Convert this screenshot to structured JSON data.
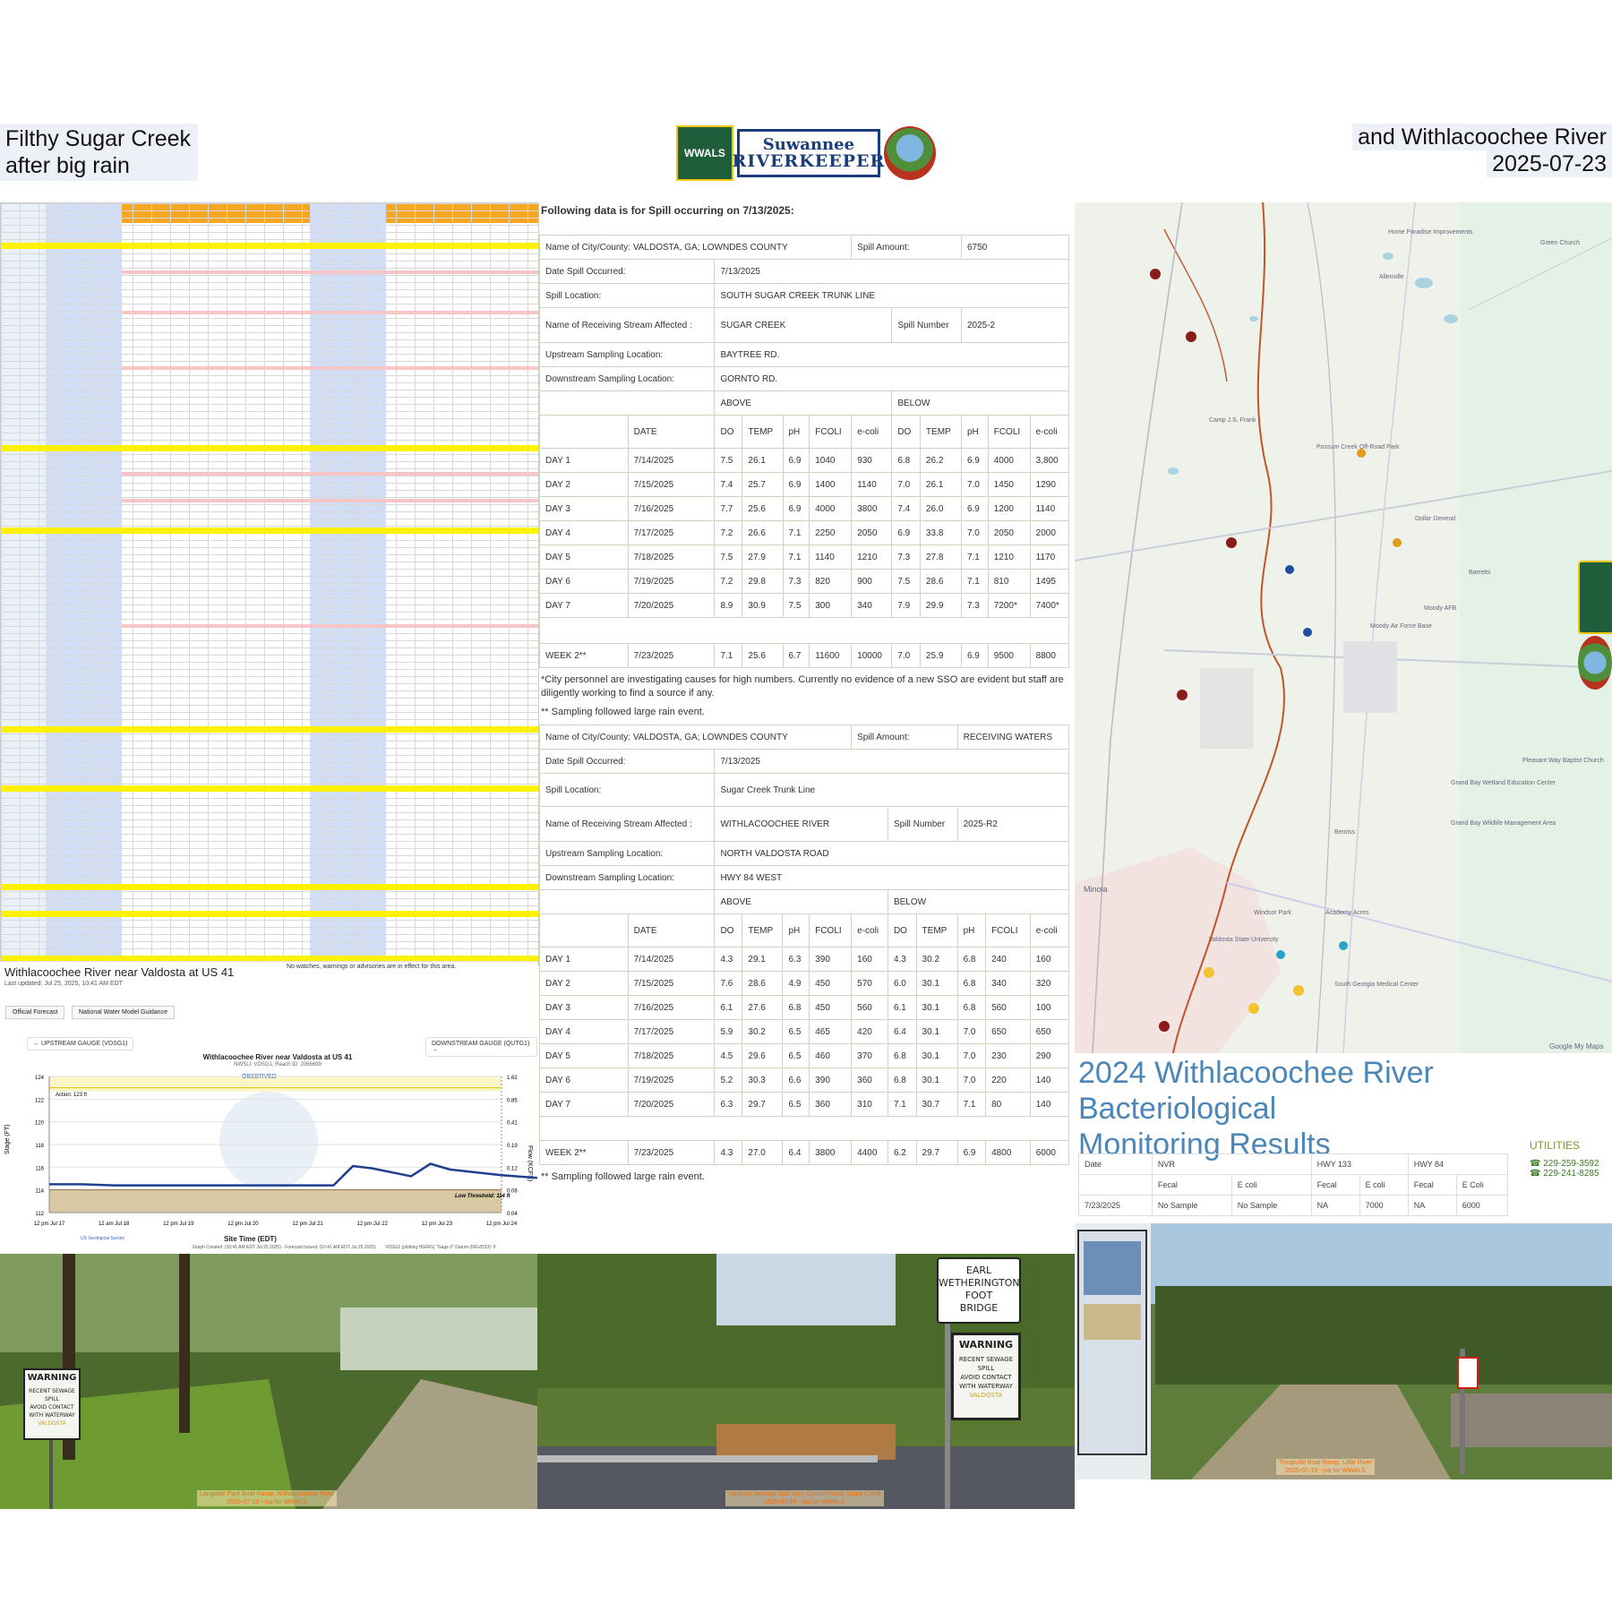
{
  "header": {
    "left_line1": "Filthy Sugar Creek",
    "left_line2": "after big rain",
    "right_line1": "and Withlacoochee River",
    "right_line2": "2025-07-23"
  },
  "logos": {
    "wwals": "WWALS",
    "riverkeeper_line1": "Suwannee",
    "riverkeeper_line2": "RIVERKEEPER",
    "little_river": "Little River"
  },
  "spill_tables": {
    "title": "Following data is for Spill occurring on 7/13/2025:",
    "table1": {
      "city_label": "Name of City/County: VALDOSTA, GA; LOWNDES COUNTY",
      "amount_label": "Spill Amount:",
      "amount_value": "6750",
      "date_label": "Date Spill Occurred:",
      "date_value": "7/13/2025",
      "location_label": "Spill Location:",
      "location_value": "SOUTH SUGAR CREEK TRUNK LINE",
      "stream_label": "Name of Receiving Stream Affected :",
      "stream_value": "SUGAR CREEK",
      "number_label": "Spill Number",
      "number_value": "2025-2",
      "upstream_label": "Upstream Sampling Location:",
      "upstream_value": "BAYTREE RD.",
      "downstream_label": "Downstream Sampling Location:",
      "downstream_value": "GORNTO RD.",
      "above": "ABOVE",
      "below": "BELOW",
      "columns": [
        "DATE",
        "DO",
        "TEMP",
        "pH",
        "FCOLI",
        "e-coli",
        "DO",
        "TEMP",
        "pH",
        "FCOLI",
        "e-coli"
      ],
      "rows": [
        [
          "DAY 1",
          "7/14/2025",
          "7.5",
          "26.1",
          "6.9",
          "1040",
          "930",
          "6.8",
          "26.2",
          "6.9",
          "4000",
          "3,800"
        ],
        [
          "DAY 2",
          "7/15/2025",
          "7.4",
          "25.7",
          "6.9",
          "1400",
          "1140",
          "7.0",
          "26.1",
          "7.0",
          "1450",
          "1290"
        ],
        [
          "DAY 3",
          "7/16/2025",
          "7.7",
          "25.6",
          "6.9",
          "4000",
          "3800",
          "7.4",
          "26.0",
          "6.9",
          "1200",
          "1140"
        ],
        [
          "DAY 4",
          "7/17/2025",
          "7.2",
          "26.6",
          "7.1",
          "2250",
          "2050",
          "6.9",
          "33.8",
          "7.0",
          "2050",
          "2000"
        ],
        [
          "DAY 5",
          "7/18/2025",
          "7.5",
          "27.9",
          "7.1",
          "1140",
          "1210",
          "7.3",
          "27.8",
          "7.1",
          "1210",
          "1170"
        ],
        [
          "DAY 6",
          "7/19/2025",
          "7.2",
          "29.8",
          "7.3",
          "820",
          "900",
          "7.5",
          "28.6",
          "7.1",
          "810",
          "1495"
        ],
        [
          "DAY 7",
          "7/20/2025",
          "8.9",
          "30.9",
          "7.5",
          "300",
          "340",
          "7.9",
          "29.9",
          "7.3",
          "7200*",
          "7400*"
        ]
      ],
      "week_row": [
        "WEEK 2**",
        "7/23/2025",
        "7.1",
        "25.6",
        "6.7",
        "11600",
        "10000",
        "7.0",
        "25.9",
        "6.9",
        "9500",
        "8800"
      ]
    },
    "note1": "*City personnel are investigating causes for high numbers. Currently no evidence of a new SSO are evident but staff are diligently working to find a source if any.",
    "note2": "** Sampling followed large rain event.",
    "table2": {
      "city_label": "Name of City/County: VALDOSTA, GA; LOWNDES COUNTY",
      "amount_label": "Spill Amount:",
      "amount_value": "RECEIVING WATERS",
      "date_label": "Date Spill Occurred:",
      "date_value": "7/13/2025",
      "location_label": "Spill Location:",
      "location_value": "Sugar Creek Trunk Line",
      "stream_label": "Name of Receiving Stream Affected :",
      "stream_value": "WITHLACOOCHEE RIVER",
      "number_label": "Spill Number",
      "number_value": "2025-R2",
      "upstream_label": "Upstream Sampling Location:",
      "upstream_value": "NORTH VALDOSTA ROAD",
      "downstream_label": "Downstream Sampling Location:",
      "downstream_value": "HWY 84 WEST",
      "above": "ABOVE",
      "below": "BELOW",
      "columns": [
        "DATE",
        "DO",
        "TEMP",
        "pH",
        "FCOLI",
        "e-coli",
        "DO",
        "TEMP",
        "pH",
        "FCOLI",
        "e-coli"
      ],
      "rows": [
        [
          "DAY 1",
          "7/14/2025",
          "4.3",
          "29.1",
          "6.3",
          "390",
          "160",
          "4.3",
          "30.2",
          "6.8",
          "240",
          "160"
        ],
        [
          "DAY 2",
          "7/15/2025",
          "7.6",
          "28.6",
          "4.9",
          "450",
          "570",
          "6.0",
          "30.1",
          "6.8",
          "340",
          "320"
        ],
        [
          "DAY 3",
          "7/16/2025",
          "6.1",
          "27.6",
          "6.8",
          "450",
          "560",
          "6.1",
          "30.1",
          "6.8",
          "560",
          "100"
        ],
        [
          "DAY 4",
          "7/17/2025",
          "5.9",
          "30.2",
          "6.5",
          "465",
          "420",
          "6.4",
          "30.1",
          "7.0",
          "650",
          "650"
        ],
        [
          "DAY 5",
          "7/18/2025",
          "4.5",
          "29.6",
          "6.5",
          "460",
          "370",
          "6.8",
          "30.1",
          "7.0",
          "230",
          "290"
        ],
        [
          "DAY 6",
          "7/19/2025",
          "5.2",
          "30.3",
          "6.6",
          "390",
          "360",
          "6.8",
          "30.1",
          "7.0",
          "220",
          "140"
        ],
        [
          "DAY 7",
          "7/20/2025",
          "6.3",
          "29.7",
          "6.5",
          "360",
          "310",
          "7.1",
          "30.7",
          "7.1",
          "80",
          "140"
        ]
      ],
      "week_row": [
        "WEEK 2**",
        "7/23/2025",
        "4.3",
        "27.0",
        "6.4",
        "3800",
        "4400",
        "6.2",
        "29.7",
        "6.9",
        "4800",
        "6000"
      ]
    },
    "note3": "** Sampling followed large rain event."
  },
  "gauge": {
    "title": "Withlacoochee River near Valdosta at US 41",
    "updated": "Last updated: Jul 25, 2025, 10:41 AM EDT",
    "warning": "No watches, warnings or advisories are in effect for this area.",
    "tab1": "Official Forecast",
    "tab2": "National Water Model Guidance",
    "upstream": "← UPSTREAM GAUGE (VDSG1)",
    "downstream": "DOWNSTREAM GAUGE (QUTG1) →",
    "chart_title": "Withlacoochee River near Valdosta at US 41",
    "chart_subtitle": "NWSLI: VDSG1, Reach ID: 2066699",
    "observed": "OBSERVED",
    "action": "Action: 123 ft",
    "low_threshold": "Low Threshold: 114 ft",
    "xlabel": "Site Time (EDT)",
    "ylabel": "Stage (FT)",
    "y2label": "Flow (KCFS)",
    "footer": "Graph Created: (10:41 AM EDT Jul 25 2025) - Forecast Issued: (10:41 AM EDT Jul 25 2025)",
    "footer2": "VDSG1 (plotting HGIRG) \"Gage 0\" Datum (NGVD29): 0'",
    "usgs": "US Geological Survey"
  },
  "chart_data": {
    "type": "line",
    "title": "Withlacoochee River near Valdosta at US 41",
    "xlabel": "Site Time (EDT)",
    "ylabel": "Stage (FT)",
    "x_ticks": [
      "12 pm Jul 17",
      "12 am Jul 18",
      "12 pm Jul 19",
      "12 pm Jul 20",
      "12 pm Jul 21",
      "12 pm Jul 22",
      "12 pm Jul 23",
      "12 pm Jul 24"
    ],
    "y_ticks": [
      112,
      114,
      116,
      118,
      120,
      122,
      124
    ],
    "y2_ticks": [
      "0.04",
      "0.08",
      "0.12",
      "0.19",
      "0.41",
      "0.85",
      "1.62"
    ],
    "ylim": [
      112,
      124
    ],
    "thresholds": {
      "action": 123,
      "low": 114
    },
    "series": [
      {
        "name": "OBSERVED",
        "x": [
          0,
          0.5,
          1,
          2,
          3,
          4,
          4.4,
          4.7,
          5,
          5.6,
          5.9,
          6.2,
          7,
          7.7
        ],
        "values": [
          114.5,
          114.5,
          114.4,
          114.4,
          114.4,
          114.4,
          114.4,
          116.1,
          115.9,
          115.2,
          116.3,
          115.8,
          115.3,
          115.0
        ]
      }
    ]
  },
  "monitoring": {
    "title_line1": "2024 Withlacoochee River Bacteriological",
    "title_line2": "Monitoring Results",
    "header": [
      "Date",
      "NVR",
      "",
      "HWY 133",
      "",
      "HWY 84",
      ""
    ],
    "subheader": [
      "",
      "Fecal",
      "E coli",
      "Fecal",
      "E coli",
      "Fecal",
      "E Coli"
    ],
    "row": [
      "7/23/2025",
      "No Sample",
      "No Sample",
      "NA",
      "7000",
      "NA",
      "6000"
    ],
    "utilities_title": "UTILITIES",
    "phone1": "229-259-3592",
    "phone2": "229-241-8285"
  },
  "map": {
    "labels": [
      "Home Paradise Improvements",
      "Allenville",
      "Green Church",
      "Camp J.S. Frank",
      "Possum Creek Off-Road Park",
      "Dollar General",
      "Moody AFB",
      "Barretts",
      "Grand Bay Wetland Education Center",
      "Grand Bay Wildlife Management Area",
      "Minola",
      "Valdosta State University",
      "South Georgia Medical Center",
      "Academy Acres",
      "Windsor Park",
      "Bemiss",
      "Moody Air Force Base",
      "Pleasant Way Baptist Church"
    ],
    "google": "Google My Maps"
  },
  "photos": {
    "caption1_line1": "Langdale Park Boat Ramp, Withlacoochee River",
    "caption1_line2": "2025-07-19 --jsq for WWALS",
    "caption2_line1": "Valdosta Sewage Spill sign, Gornto Road, Sugar Creek",
    "caption2_line2": "2025-07-19 --jsq for WWALS",
    "caption3_line1": "Troupville Boat Ramp, Little River",
    "caption3_line2": "2025-07-19 --jsq for WWALS",
    "sign_warning": "WARNING",
    "sign_l1": "RECENT SEWAGE",
    "sign_l2": "SPILL",
    "sign_l3": "AVOID CONTACT",
    "sign_l4": "WITH WATERWAY",
    "sign_l5": "VALDOSTA",
    "bridge_l1": "EARL",
    "bridge_l2": "WETHERINGTON",
    "bridge_l3": "FOOT",
    "bridge_l4": "BRIDGE"
  }
}
